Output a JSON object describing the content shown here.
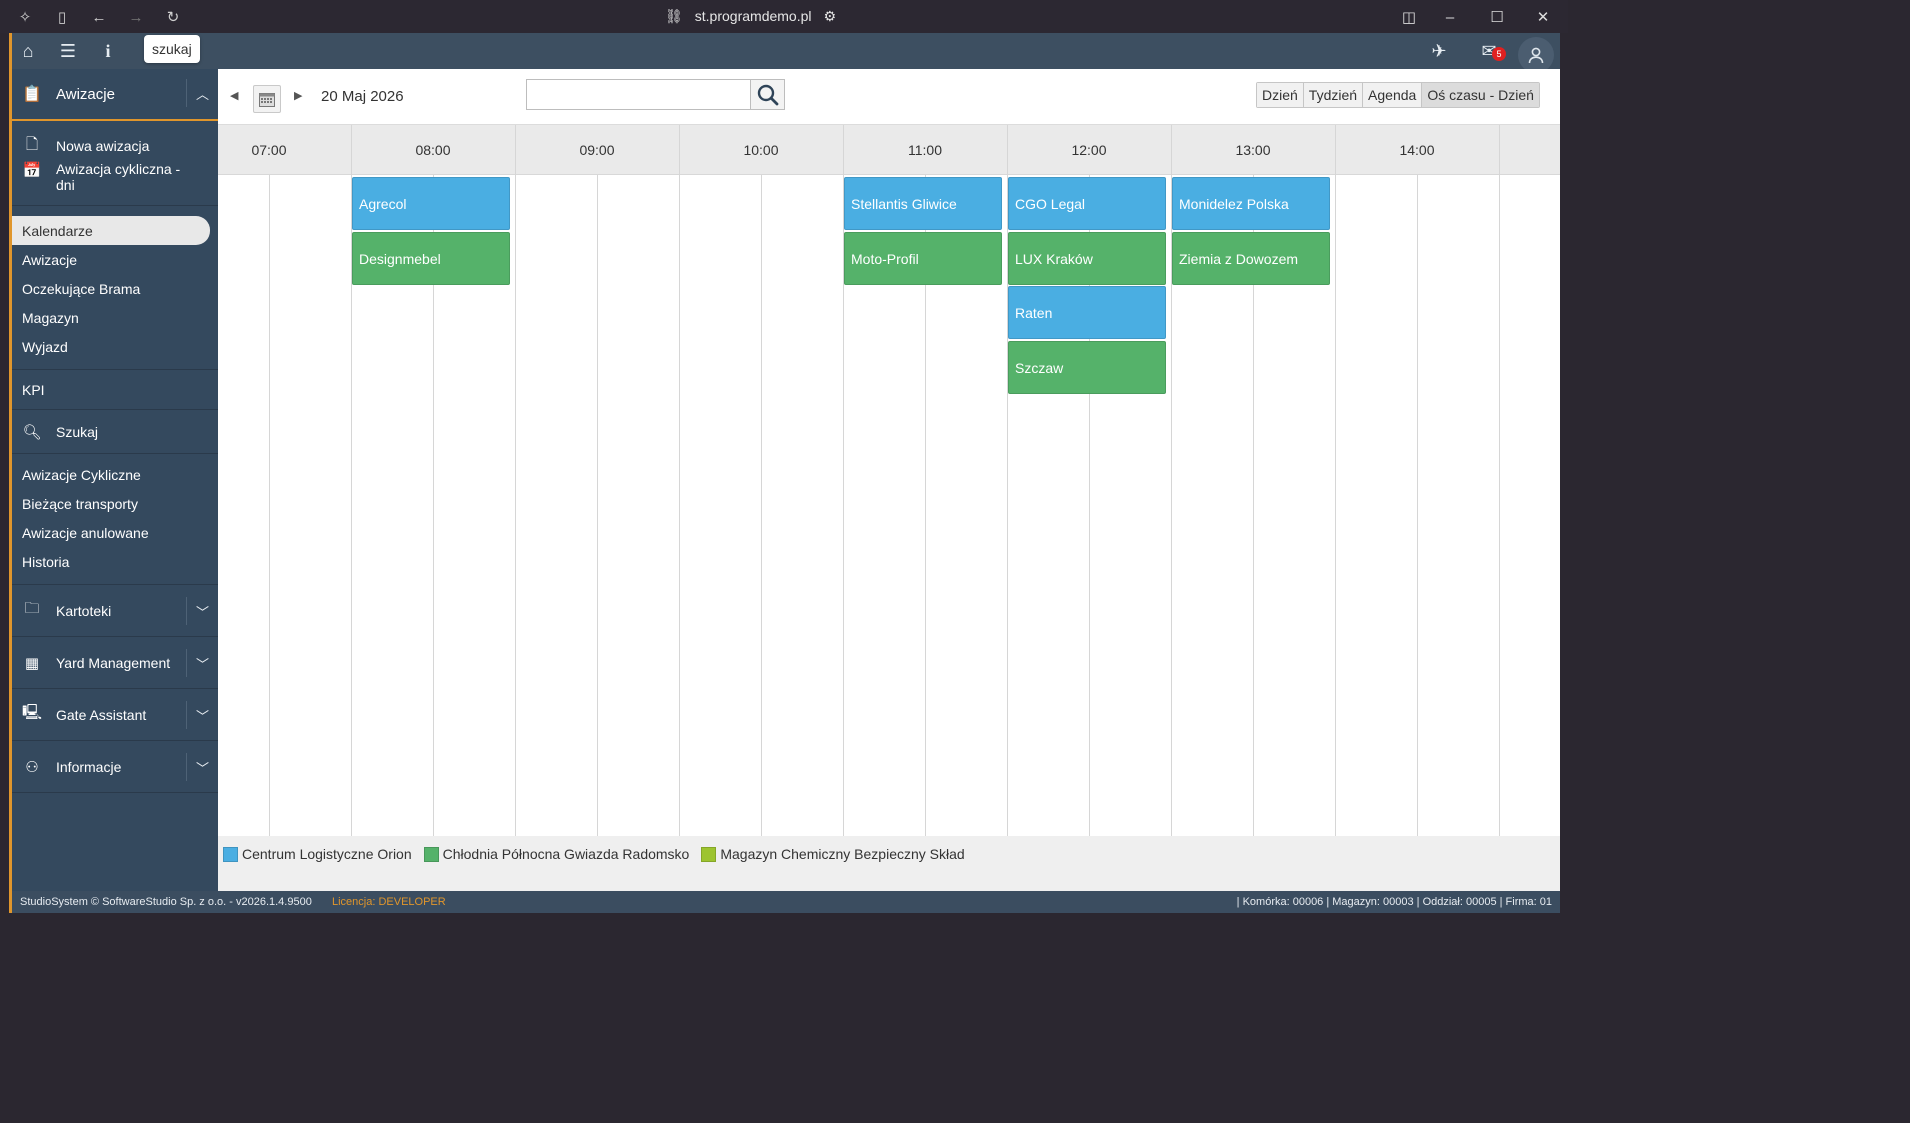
{
  "browser": {
    "url": "st.programdemo.pl"
  },
  "topbar": {
    "tooltip": "szukaj",
    "mail_count": "5"
  },
  "sidebar": {
    "header": "Awizacje",
    "actions": [
      "Nowa awizacja",
      "Awizacja cykliczna - dni"
    ],
    "group1": [
      "Kalendarze",
      "Awizacje",
      "Oczekujące Brama",
      "Magazyn",
      "Wyjazd"
    ],
    "kpi": "KPI",
    "search": "Szukaj",
    "group2": [
      "Awizacje Cykliczne",
      "Bieżące transporty",
      "Awizacje anulowane",
      "Historia"
    ],
    "sections": [
      "Kartoteki",
      "Yard Management",
      "Gate Assistant",
      "Informacje"
    ]
  },
  "calendar": {
    "date": "20 Maj 2026",
    "views": [
      "Dzień",
      "Tydzień",
      "Agenda",
      "Oś czasu - Dzień"
    ],
    "hours": [
      "07:00",
      "08:00",
      "09:00",
      "10:00",
      "11:00",
      "12:00",
      "13:00",
      "14:00"
    ],
    "events": [
      {
        "name": "Agrecol",
        "hour": "08:00",
        "row": 0,
        "color": "#4aaee2"
      },
      {
        "name": "Designmebel",
        "hour": "08:00",
        "row": 1,
        "color": "#55b26a"
      },
      {
        "name": "Stellantis Gliwice",
        "hour": "11:00",
        "row": 0,
        "color": "#4aaee2"
      },
      {
        "name": "Moto-Profil",
        "hour": "11:00",
        "row": 1,
        "color": "#55b26a"
      },
      {
        "name": "CGO Legal",
        "hour": "12:00",
        "row": 0,
        "color": "#4aaee2"
      },
      {
        "name": "LUX Kraków",
        "hour": "12:00",
        "row": 1,
        "color": "#55b26a"
      },
      {
        "name": "Raten",
        "hour": "12:00",
        "row": 2,
        "color": "#4aaee2"
      },
      {
        "name": "Szczaw",
        "hour": "12:00",
        "row": 3,
        "color": "#55b26a"
      },
      {
        "name": "Monidelez Polska",
        "hour": "13:00",
        "row": 0,
        "color": "#4aaee2"
      },
      {
        "name": "Ziemia z Dowozem",
        "hour": "13:00",
        "row": 1,
        "color": "#55b26a"
      }
    ],
    "legend": [
      {
        "label": "Centrum Logistyczne Orion",
        "color": "#4aaee2"
      },
      {
        "label": "Chłodnia Północna Gwiazda Radomsko",
        "color": "#55b26a"
      },
      {
        "label": "Magazyn Chemiczny Bezpieczny Skład",
        "color": "#9dc42f"
      }
    ]
  },
  "status": {
    "left": "StudioSystem © SoftwareStudio Sp. z o.o. - v2026.1.4.9500",
    "license": "Licencja: DEVELOPER",
    "right": "| Komórka: 00006 | Magazyn: 00003 | Oddział: 00005 | Firma: 01"
  }
}
